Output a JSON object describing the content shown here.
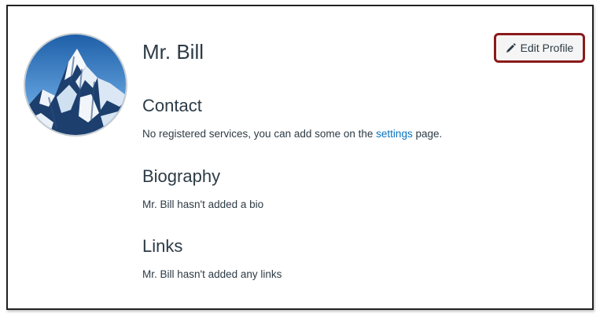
{
  "profile": {
    "name": "Mr. Bill",
    "edit_button_label": "Edit Profile"
  },
  "contact": {
    "title": "Contact",
    "text_before": "No registered services, you can add some on the ",
    "link_text": "settings",
    "text_after": " page."
  },
  "biography": {
    "title": "Biography",
    "text": "Mr. Bill hasn't added a bio"
  },
  "links": {
    "title": "Links",
    "text": "Mr. Bill hasn't added any links"
  },
  "colors": {
    "link": "#0772c0",
    "button_highlight": "#8b1a1a",
    "text": "#2d3b45"
  }
}
